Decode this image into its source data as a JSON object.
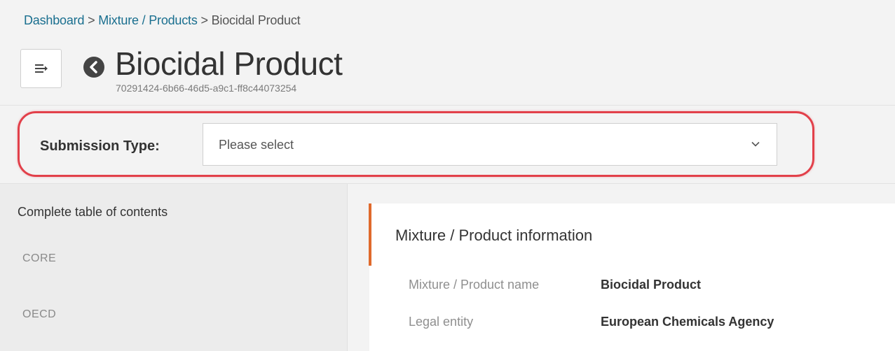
{
  "breadcrumb": {
    "items": [
      "Dashboard",
      "Mixture / Products",
      "Biocidal Product"
    ],
    "separator": ">"
  },
  "header": {
    "title": "Biocidal Product",
    "uuid": "70291424-6b66-46d5-a9c1-ff8c44073254",
    "menu_icon": "menu-arrow-icon",
    "back_icon": "back-circle-icon"
  },
  "submission": {
    "label": "Submission Type:",
    "placeholder": "Please select",
    "highlight_color": "#e2404a"
  },
  "toc": {
    "title": "Complete table of contents",
    "items": [
      "CORE",
      "OECD"
    ]
  },
  "info": {
    "section_title": "Mixture / Product information",
    "accent_color": "#e06a2c",
    "fields": [
      {
        "label": "Mixture / Product name",
        "value": "Biocidal Product"
      },
      {
        "label": "Legal entity",
        "value": "European Chemicals Agency"
      }
    ]
  },
  "colors": {
    "link": "#1a6f8f",
    "background": "#f3f3f3",
    "sidebar": "#ececec"
  }
}
